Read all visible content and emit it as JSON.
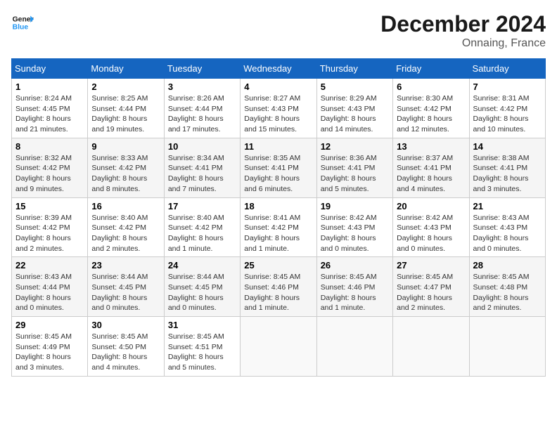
{
  "header": {
    "logo_line1": "General",
    "logo_line2": "Blue",
    "month": "December 2024",
    "location": "Onnaing, France"
  },
  "weekdays": [
    "Sunday",
    "Monday",
    "Tuesday",
    "Wednesday",
    "Thursday",
    "Friday",
    "Saturday"
  ],
  "weeks": [
    [
      {
        "day": "1",
        "sunrise": "8:24 AM",
        "sunset": "4:45 PM",
        "daylight": "8 hours and 21 minutes."
      },
      {
        "day": "2",
        "sunrise": "8:25 AM",
        "sunset": "4:44 PM",
        "daylight": "8 hours and 19 minutes."
      },
      {
        "day": "3",
        "sunrise": "8:26 AM",
        "sunset": "4:44 PM",
        "daylight": "8 hours and 17 minutes."
      },
      {
        "day": "4",
        "sunrise": "8:27 AM",
        "sunset": "4:43 PM",
        "daylight": "8 hours and 15 minutes."
      },
      {
        "day": "5",
        "sunrise": "8:29 AM",
        "sunset": "4:43 PM",
        "daylight": "8 hours and 14 minutes."
      },
      {
        "day": "6",
        "sunrise": "8:30 AM",
        "sunset": "4:42 PM",
        "daylight": "8 hours and 12 minutes."
      },
      {
        "day": "7",
        "sunrise": "8:31 AM",
        "sunset": "4:42 PM",
        "daylight": "8 hours and 10 minutes."
      }
    ],
    [
      {
        "day": "8",
        "sunrise": "8:32 AM",
        "sunset": "4:42 PM",
        "daylight": "8 hours and 9 minutes."
      },
      {
        "day": "9",
        "sunrise": "8:33 AM",
        "sunset": "4:42 PM",
        "daylight": "8 hours and 8 minutes."
      },
      {
        "day": "10",
        "sunrise": "8:34 AM",
        "sunset": "4:41 PM",
        "daylight": "8 hours and 7 minutes."
      },
      {
        "day": "11",
        "sunrise": "8:35 AM",
        "sunset": "4:41 PM",
        "daylight": "8 hours and 6 minutes."
      },
      {
        "day": "12",
        "sunrise": "8:36 AM",
        "sunset": "4:41 PM",
        "daylight": "8 hours and 5 minutes."
      },
      {
        "day": "13",
        "sunrise": "8:37 AM",
        "sunset": "4:41 PM",
        "daylight": "8 hours and 4 minutes."
      },
      {
        "day": "14",
        "sunrise": "8:38 AM",
        "sunset": "4:41 PM",
        "daylight": "8 hours and 3 minutes."
      }
    ],
    [
      {
        "day": "15",
        "sunrise": "8:39 AM",
        "sunset": "4:42 PM",
        "daylight": "8 hours and 2 minutes."
      },
      {
        "day": "16",
        "sunrise": "8:40 AM",
        "sunset": "4:42 PM",
        "daylight": "8 hours and 2 minutes."
      },
      {
        "day": "17",
        "sunrise": "8:40 AM",
        "sunset": "4:42 PM",
        "daylight": "8 hours and 1 minute."
      },
      {
        "day": "18",
        "sunrise": "8:41 AM",
        "sunset": "4:42 PM",
        "daylight": "8 hours and 1 minute."
      },
      {
        "day": "19",
        "sunrise": "8:42 AM",
        "sunset": "4:43 PM",
        "daylight": "8 hours and 0 minutes."
      },
      {
        "day": "20",
        "sunrise": "8:42 AM",
        "sunset": "4:43 PM",
        "daylight": "8 hours and 0 minutes."
      },
      {
        "day": "21",
        "sunrise": "8:43 AM",
        "sunset": "4:43 PM",
        "daylight": "8 hours and 0 minutes."
      }
    ],
    [
      {
        "day": "22",
        "sunrise": "8:43 AM",
        "sunset": "4:44 PM",
        "daylight": "8 hours and 0 minutes."
      },
      {
        "day": "23",
        "sunrise": "8:44 AM",
        "sunset": "4:45 PM",
        "daylight": "8 hours and 0 minutes."
      },
      {
        "day": "24",
        "sunrise": "8:44 AM",
        "sunset": "4:45 PM",
        "daylight": "8 hours and 0 minutes."
      },
      {
        "day": "25",
        "sunrise": "8:45 AM",
        "sunset": "4:46 PM",
        "daylight": "8 hours and 1 minute."
      },
      {
        "day": "26",
        "sunrise": "8:45 AM",
        "sunset": "4:46 PM",
        "daylight": "8 hours and 1 minute."
      },
      {
        "day": "27",
        "sunrise": "8:45 AM",
        "sunset": "4:47 PM",
        "daylight": "8 hours and 2 minutes."
      },
      {
        "day": "28",
        "sunrise": "8:45 AM",
        "sunset": "4:48 PM",
        "daylight": "8 hours and 2 minutes."
      }
    ],
    [
      {
        "day": "29",
        "sunrise": "8:45 AM",
        "sunset": "4:49 PM",
        "daylight": "8 hours and 3 minutes."
      },
      {
        "day": "30",
        "sunrise": "8:45 AM",
        "sunset": "4:50 PM",
        "daylight": "8 hours and 4 minutes."
      },
      {
        "day": "31",
        "sunrise": "8:45 AM",
        "sunset": "4:51 PM",
        "daylight": "8 hours and 5 minutes."
      },
      null,
      null,
      null,
      null
    ]
  ]
}
